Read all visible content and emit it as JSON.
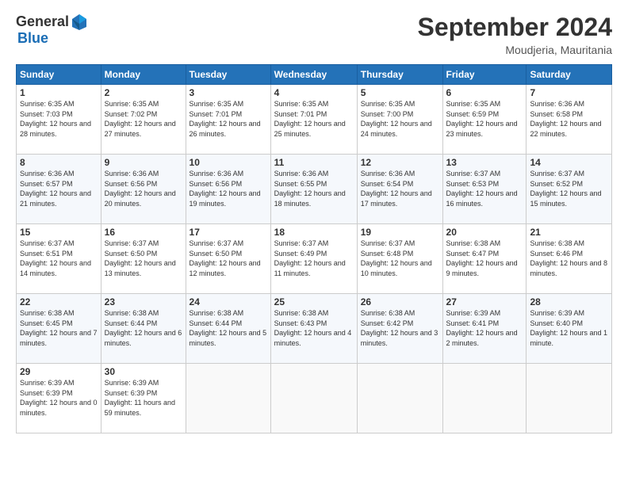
{
  "logo": {
    "general": "General",
    "blue": "Blue"
  },
  "header": {
    "month_year": "September 2024",
    "location": "Moudjeria, Mauritania"
  },
  "weekdays": [
    "Sunday",
    "Monday",
    "Tuesday",
    "Wednesday",
    "Thursday",
    "Friday",
    "Saturday"
  ],
  "weeks": [
    [
      {
        "day": "1",
        "sunrise": "6:35 AM",
        "sunset": "7:03 PM",
        "daylight": "12 hours and 28 minutes."
      },
      {
        "day": "2",
        "sunrise": "6:35 AM",
        "sunset": "7:02 PM",
        "daylight": "12 hours and 27 minutes."
      },
      {
        "day": "3",
        "sunrise": "6:35 AM",
        "sunset": "7:01 PM",
        "daylight": "12 hours and 26 minutes."
      },
      {
        "day": "4",
        "sunrise": "6:35 AM",
        "sunset": "7:01 PM",
        "daylight": "12 hours and 25 minutes."
      },
      {
        "day": "5",
        "sunrise": "6:35 AM",
        "sunset": "7:00 PM",
        "daylight": "12 hours and 24 minutes."
      },
      {
        "day": "6",
        "sunrise": "6:35 AM",
        "sunset": "6:59 PM",
        "daylight": "12 hours and 23 minutes."
      },
      {
        "day": "7",
        "sunrise": "6:36 AM",
        "sunset": "6:58 PM",
        "daylight": "12 hours and 22 minutes."
      }
    ],
    [
      {
        "day": "8",
        "sunrise": "6:36 AM",
        "sunset": "6:57 PM",
        "daylight": "12 hours and 21 minutes."
      },
      {
        "day": "9",
        "sunrise": "6:36 AM",
        "sunset": "6:56 PM",
        "daylight": "12 hours and 20 minutes."
      },
      {
        "day": "10",
        "sunrise": "6:36 AM",
        "sunset": "6:56 PM",
        "daylight": "12 hours and 19 minutes."
      },
      {
        "day": "11",
        "sunrise": "6:36 AM",
        "sunset": "6:55 PM",
        "daylight": "12 hours and 18 minutes."
      },
      {
        "day": "12",
        "sunrise": "6:36 AM",
        "sunset": "6:54 PM",
        "daylight": "12 hours and 17 minutes."
      },
      {
        "day": "13",
        "sunrise": "6:37 AM",
        "sunset": "6:53 PM",
        "daylight": "12 hours and 16 minutes."
      },
      {
        "day": "14",
        "sunrise": "6:37 AM",
        "sunset": "6:52 PM",
        "daylight": "12 hours and 15 minutes."
      }
    ],
    [
      {
        "day": "15",
        "sunrise": "6:37 AM",
        "sunset": "6:51 PM",
        "daylight": "12 hours and 14 minutes."
      },
      {
        "day": "16",
        "sunrise": "6:37 AM",
        "sunset": "6:50 PM",
        "daylight": "12 hours and 13 minutes."
      },
      {
        "day": "17",
        "sunrise": "6:37 AM",
        "sunset": "6:50 PM",
        "daylight": "12 hours and 12 minutes."
      },
      {
        "day": "18",
        "sunrise": "6:37 AM",
        "sunset": "6:49 PM",
        "daylight": "12 hours and 11 minutes."
      },
      {
        "day": "19",
        "sunrise": "6:37 AM",
        "sunset": "6:48 PM",
        "daylight": "12 hours and 10 minutes."
      },
      {
        "day": "20",
        "sunrise": "6:38 AM",
        "sunset": "6:47 PM",
        "daylight": "12 hours and 9 minutes."
      },
      {
        "day": "21",
        "sunrise": "6:38 AM",
        "sunset": "6:46 PM",
        "daylight": "12 hours and 8 minutes."
      }
    ],
    [
      {
        "day": "22",
        "sunrise": "6:38 AM",
        "sunset": "6:45 PM",
        "daylight": "12 hours and 7 minutes."
      },
      {
        "day": "23",
        "sunrise": "6:38 AM",
        "sunset": "6:44 PM",
        "daylight": "12 hours and 6 minutes."
      },
      {
        "day": "24",
        "sunrise": "6:38 AM",
        "sunset": "6:44 PM",
        "daylight": "12 hours and 5 minutes."
      },
      {
        "day": "25",
        "sunrise": "6:38 AM",
        "sunset": "6:43 PM",
        "daylight": "12 hours and 4 minutes."
      },
      {
        "day": "26",
        "sunrise": "6:38 AM",
        "sunset": "6:42 PM",
        "daylight": "12 hours and 3 minutes."
      },
      {
        "day": "27",
        "sunrise": "6:39 AM",
        "sunset": "6:41 PM",
        "daylight": "12 hours and 2 minutes."
      },
      {
        "day": "28",
        "sunrise": "6:39 AM",
        "sunset": "6:40 PM",
        "daylight": "12 hours and 1 minute."
      }
    ],
    [
      {
        "day": "29",
        "sunrise": "6:39 AM",
        "sunset": "6:39 PM",
        "daylight": "12 hours and 0 minutes."
      },
      {
        "day": "30",
        "sunrise": "6:39 AM",
        "sunset": "6:39 PM",
        "daylight": "11 hours and 59 minutes."
      },
      null,
      null,
      null,
      null,
      null
    ]
  ],
  "labels": {
    "sunrise": "Sunrise:",
    "sunset": "Sunset:",
    "daylight": "Daylight:"
  }
}
